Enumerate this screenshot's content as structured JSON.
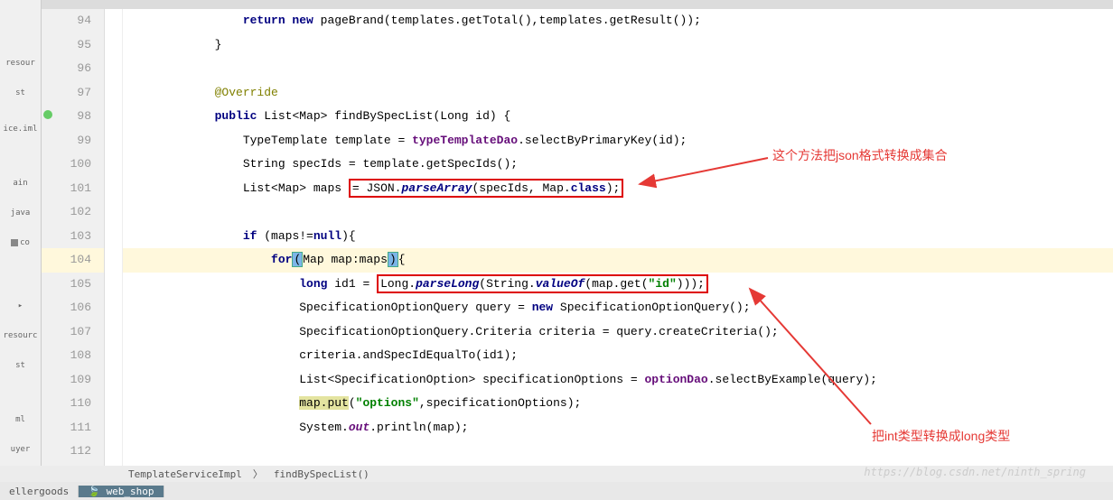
{
  "sidebar": {
    "items": [
      {
        "label": "resour"
      },
      {
        "label": "st"
      },
      {
        "label": "ice.iml"
      },
      {
        "label": "ain"
      },
      {
        "label": "java"
      },
      {
        "label": "co"
      },
      {
        "label": "resourc"
      },
      {
        "label": "st"
      },
      {
        "label": "ml"
      },
      {
        "label": "uyer"
      }
    ]
  },
  "lineNumbers": [
    "94",
    "95",
    "96",
    "97",
    "98",
    "99",
    "100",
    "101",
    "102",
    "103",
    "104",
    "105",
    "106",
    "107",
    "108",
    "109",
    "110",
    "111",
    "112"
  ],
  "code": {
    "l94": {
      "indent": "                ",
      "k1": "return new",
      "mid": " pageBrand(templates.getTotal(),templates.getResult());"
    },
    "l95": {
      "indent": "            ",
      "brace": "}"
    },
    "l96": {
      "indent": ""
    },
    "l97": {
      "indent": "            ",
      "anno": "@Override"
    },
    "l98": {
      "indent": "            ",
      "k1": "public",
      "t1": " List<Map> ",
      "m1": "findBySpecList",
      "p1": "(Long id) {"
    },
    "l99": {
      "indent": "                ",
      "t1": "TypeTemplate template = ",
      "f1": "typeTemplateDao",
      "m1": ".selectByPrimaryKey(id);"
    },
    "l100": {
      "indent": "                ",
      "t1": "String specIds = template.getSpecIds();"
    },
    "l101": {
      "indent": "                ",
      "t1": "List<Map> maps ",
      "boxed": "= JSON.",
      "st1": "parseArray",
      "mid": "(specIds, Map.",
      "k1": "class",
      "end": ");"
    },
    "l102": {
      "indent": ""
    },
    "l103": {
      "indent": "                ",
      "k1": "if",
      "p1": " (maps!=",
      "k2": "null",
      "p2": "){"
    },
    "l104": {
      "indent": "                    ",
      "k1": "for",
      "cursor1": "(",
      "t1": "Map map:maps",
      "cursor2": ")",
      "brace": "{"
    },
    "l105": {
      "indent": "                        ",
      "k1": "long",
      "t1": " id1 = ",
      "boxed_pre": "Long.",
      "st1": "parseLong",
      "mid": "(String.",
      "st2": "valueOf",
      "p1": "(map.get(",
      "s1": "\"id\"",
      "end": ")));"
    },
    "l106": {
      "indent": "                        ",
      "t1": "SpecificationOptionQuery query = ",
      "k1": "new",
      "t2": " SpecificationOptionQuery();"
    },
    "l107": {
      "indent": "                        ",
      "t1": "SpecificationOptionQuery.Criteria criteria = query.createCriteria();"
    },
    "l108": {
      "indent": "                        ",
      "t1": "criteria.andSpecIdEqualTo(id1);"
    },
    "l109": {
      "indent": "                        ",
      "t1": "List<SpecificationOption> specificationOptions = ",
      "f1": "optionDao",
      "m1": ".selectByExample(query);"
    },
    "l110": {
      "indent": "                        ",
      "hl": "map.put",
      "p1": "(",
      "s1": "\"options\"",
      "p2": ",specificationOptions);"
    },
    "l111": {
      "indent": "                        ",
      "t1": "System.",
      "st1": "out",
      "m1": ".println(map);"
    },
    "l112": {
      "indent": ""
    }
  },
  "annotations": {
    "top": "这个方法把json格式转换成集合",
    "bottom": "把int类型转换成long类型"
  },
  "breadcrumbs": {
    "class": "TemplateServiceImpl",
    "method": "findBySpecList()"
  },
  "bottomBar": {
    "tab1": "ellergoods",
    "tab2": "web_shop"
  },
  "watermark": "https://blog.csdn.net/ninth_spring"
}
